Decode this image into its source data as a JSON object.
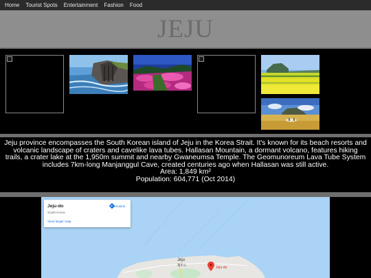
{
  "nav": {
    "items": [
      "Home",
      "Tourist Spots",
      "Entertainment",
      "Fashion",
      "Food"
    ]
  },
  "banner": {
    "title": "JEJU"
  },
  "gallery": {
    "photos": [
      {
        "subject": "broken-image"
      },
      {
        "subject": "coastal-cliffs"
      },
      {
        "subject": "pink-flower-field"
      },
      {
        "subject": "broken-image"
      },
      {
        "subject": "canola-field-with-peak"
      },
      {
        "subject": "grassland-with-peak"
      }
    ]
  },
  "description": {
    "text": "Jeju province encompasses the South Korean island of Jeju in the Korea Strait. It's known for its beach resorts and volcanic landscape of craters and cavelike lava tubes. Hallasan Mountain, a dormant volcano, features hiking trails, a crater lake at the 1,950m summit and nearby Gwaneumsa Temple. The Geomunoreum Lava Tube System includes 7km-long Manjanggul Cave, created centuries ago when Hallasan was still active.",
    "area": "Area: 1,849 km²",
    "population": "Population: 604,771 (Oct 2014)"
  },
  "map": {
    "card_title": "Jeju-do",
    "card_subtitle": "South Korea",
    "directions_label": "Directions",
    "larger_map_label": "View larger map",
    "city_label": "Jeju",
    "city_label_korean": "제주시",
    "pin_label": "Jeju-do",
    "colors": {
      "water": "#aad3f5",
      "land": "#e7e6e3",
      "park": "#c8e6c9",
      "pin": "#ea4335"
    }
  }
}
